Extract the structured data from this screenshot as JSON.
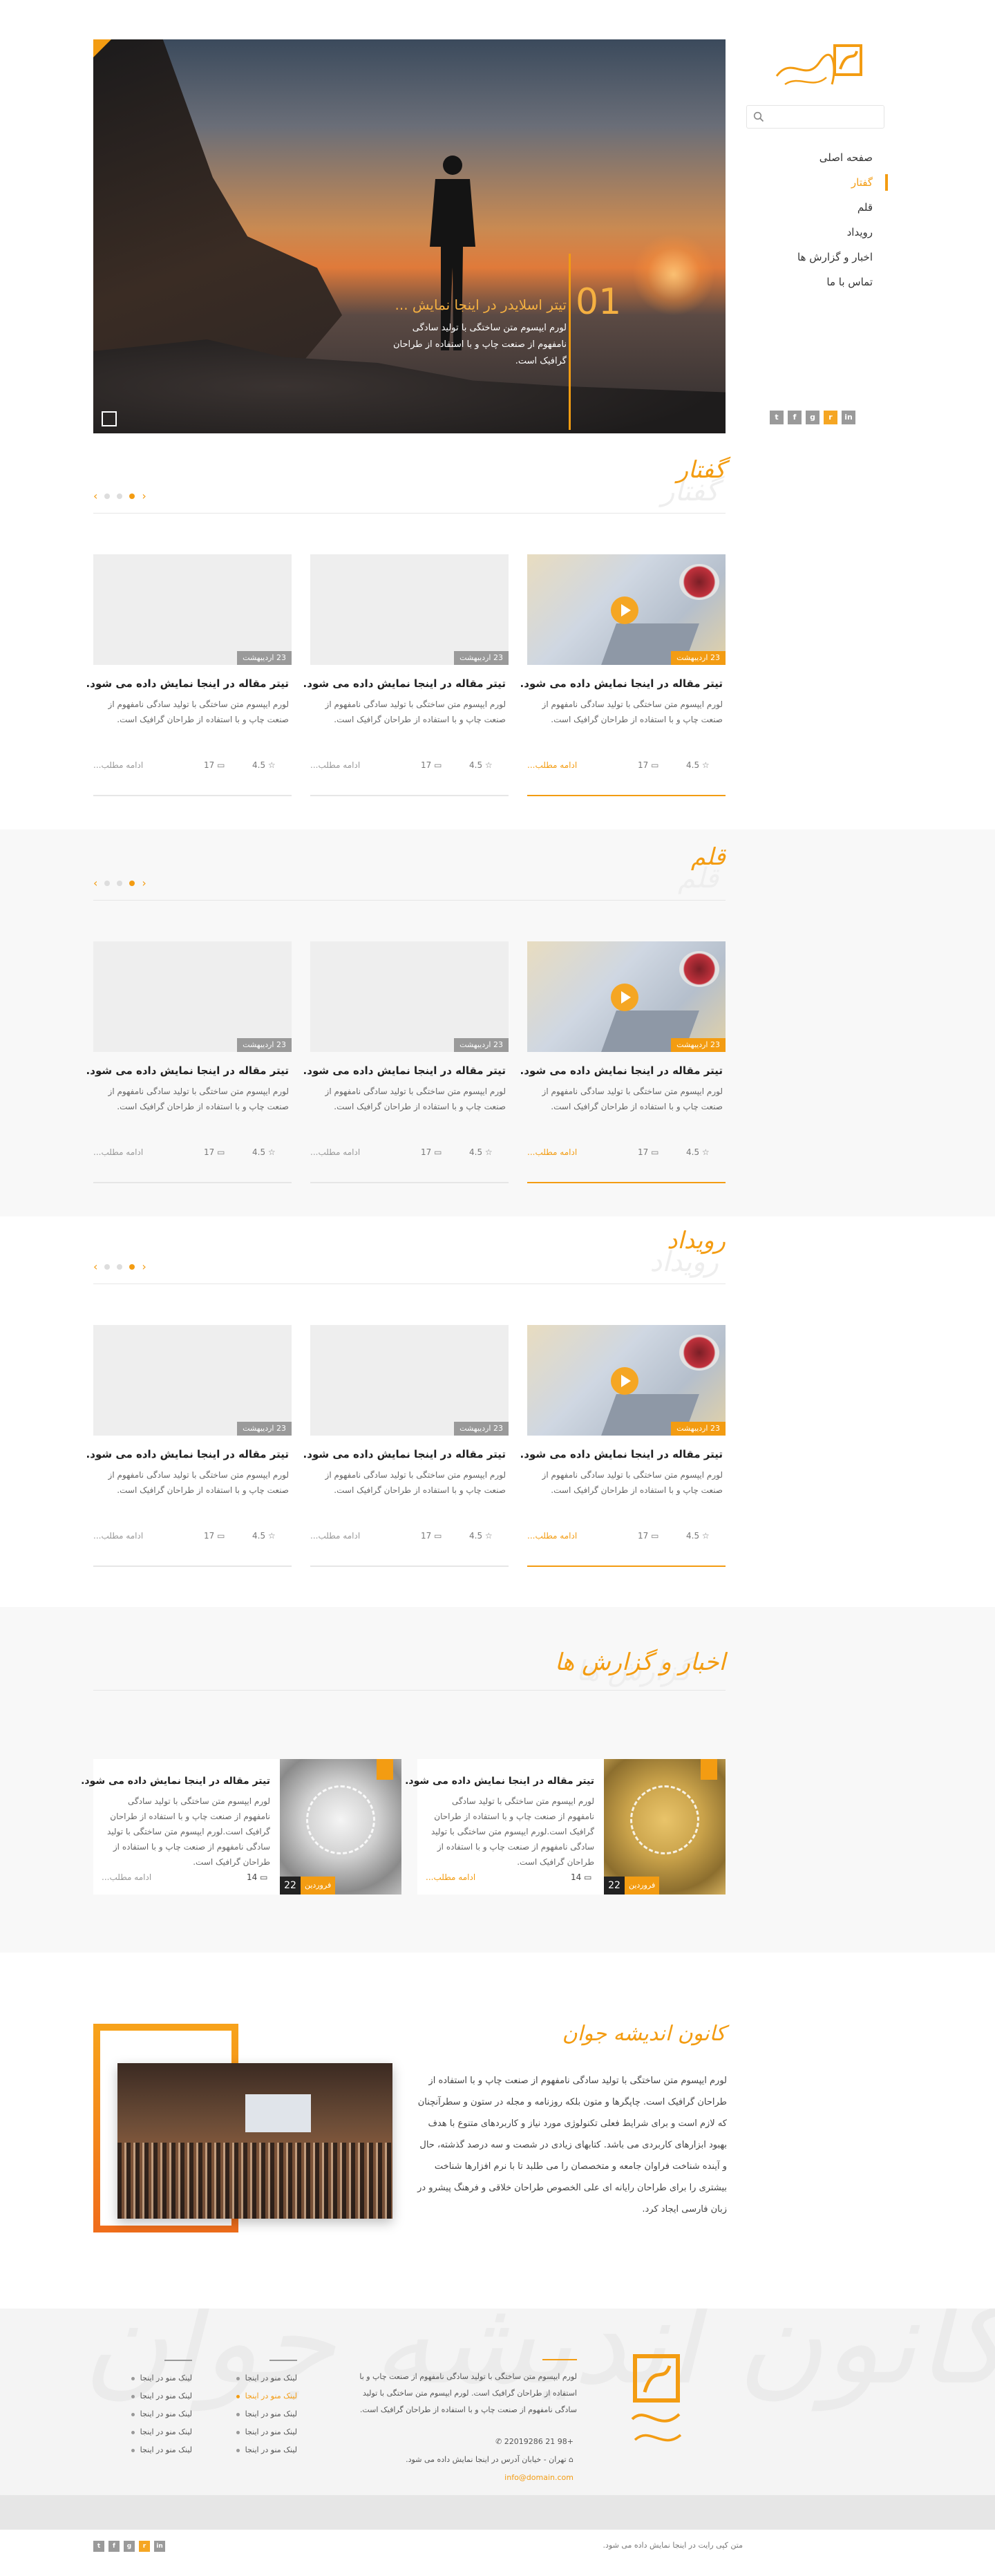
{
  "brand": {
    "logo_name": "کانون اندیشه جوان",
    "accent_color": "#f39c12"
  },
  "search": {
    "placeholder": ""
  },
  "nav": {
    "items": [
      {
        "label": "صفحه اصلی",
        "active": false
      },
      {
        "label": "گفتار",
        "active": true
      },
      {
        "label": "قلم",
        "active": false
      },
      {
        "label": "رویداد",
        "active": false
      },
      {
        "label": "اخبار و گزارش ها",
        "active": false
      },
      {
        "label": "تماس با ما",
        "active": false
      }
    ]
  },
  "social": [
    "twitter-icon",
    "facebook-icon",
    "google-plus-icon",
    "rss-icon",
    "linkedin-icon"
  ],
  "hero": {
    "number": "01",
    "title": "تیتر اسلایدر در اینجا نمایش ...",
    "text": "لورم ایپسوم متن ساختگی با تولید سادگی نامفهوم از صنعت چاپ و با استفاده از طراحان گرافیک است.",
    "slides": 4,
    "active_slide": 4
  },
  "sections": [
    {
      "title": "گفتار",
      "ghost": "گفتار"
    },
    {
      "title": "قلم",
      "ghost": "قلم"
    },
    {
      "title": "رویداد",
      "ghost": "رویداد"
    }
  ],
  "card": {
    "date": "23 اردیبهشت",
    "title": "تیتر مقاله در اینجا نمایش داده می شود.",
    "text": "لورم ایپسوم متن ساختگی با تولید سادگی نامفهوم از صنعت چاپ و با استفاده از طراحان گرافیک است.",
    "more": "ادامه مطلب...",
    "rating": "4.5",
    "comments": "17"
  },
  "news_section": {
    "title": "اخبار و گزارش ها",
    "ghost": "گزارش ها"
  },
  "news": {
    "title": "تیتر مقاله در اینجا نمایش داده می شود.",
    "text": "لورم ایپسوم متن ساختگی با تولید سادگی نامفهوم از صنعت چاپ و با استفاده از طراحان گرافیک است.لورم ایپسوم متن ساختگی با تولید سادگی نامفهوم از صنعت چاپ و با استفاده از طراحان گرافیک است.",
    "more": "ادامه مطلب...",
    "comments": "14",
    "number": "22",
    "tag": "فروردین"
  },
  "about": {
    "title": "کانون اندیشه جوان",
    "text": "لورم ایپسوم متن ساختگی با تولید سادگی نامفهوم از صنعت چاپ و با استفاده از طراحان گرافیک است. چاپگرها و متون بلکه روزنامه و مجله در ستون و سطرآنچنان که لازم است و برای شرایط فعلی تکنولوژی مورد نیاز و کاربردهای متنوع با هدف بهبود ابزارهای کاربردی می باشد. کتابهای زیادی در شصت و سه درصد گذشته، حال و آینده شناخت فراوان جامعه و متخصصان را می طلبد تا با نرم افزارها شناخت بیشتری را برای طراحان رایانه ای علی الخصوص طراحان خلاقی و فرهنگ پیشرو در زبان فارسی ایجاد کرد."
  },
  "footer": {
    "ghost": "کانون اندیشه جوان",
    "text": "لورم ایپسوم متن ساختگی با تولید سادگی نامفهوم از صنعت چاپ و با استفاده از طراحان گرافیک است. لورم ایپسوم متن ساختگی با تولید سادگی نامفهوم از صنعت چاپ و با استفاده از طراحان گرافیک است.",
    "phone": "+98 21 22019286",
    "address": "تهران - خیابان آدرس در اینجا نمایش داده می شود.",
    "email": "info@domain.com",
    "links_a": [
      "لینک منو در اینجا",
      "لینک منو در اینجا",
      "لینک منو در اینجا",
      "لینک منو در اینجا",
      "لینک منو در اینجا"
    ],
    "links_b": [
      "لینک منو در اینجا",
      "لینک منو در اینجا",
      "لینک منو در اینجا",
      "لینک منو در اینجا",
      "لینک منو در اینجا"
    ],
    "links_b_highlight": 1,
    "copyright": "متن کپی رایت در اینجا نمایش داده می شود."
  }
}
